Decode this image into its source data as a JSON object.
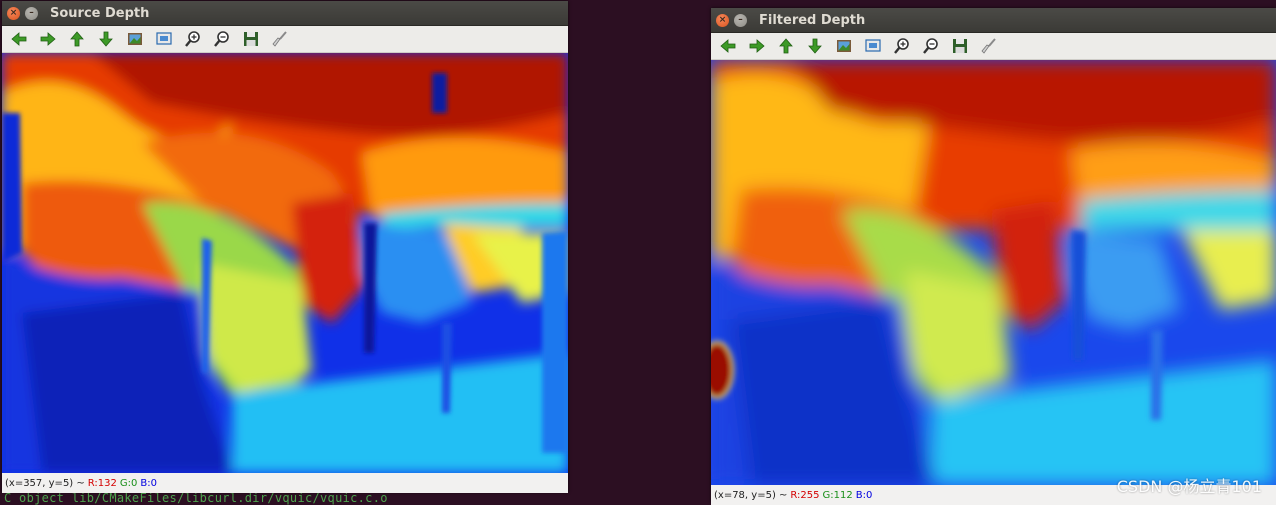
{
  "terminal": {
    "text": "C object lib/CMakeFiles/libcurl.dir/vquic/vquic.c.o"
  },
  "windows": {
    "source": {
      "title": "Source Depth",
      "status": {
        "coords": "(x=357, y=5) ~",
        "r": "R:132",
        "g": "G:0",
        "b": "B:0"
      }
    },
    "filtered": {
      "title": "Filtered Depth",
      "status": {
        "coords": "(x=78, y=5) ~",
        "r": "R:255",
        "g": "G:112",
        "b": "B:0"
      }
    }
  },
  "toolbar_icons": [
    "arrow-left-icon",
    "arrow-right-icon",
    "arrow-up-icon",
    "arrow-down-icon",
    "image-icon",
    "fit-window-icon",
    "zoom-in-icon",
    "zoom-out-icon",
    "save-icon",
    "properties-brush-icon"
  ],
  "colors": {
    "background": "#2c0f22",
    "arrow_green": "#3d9a27",
    "close_button": "#e2602a"
  },
  "watermark": "CSDN @杨立青101"
}
